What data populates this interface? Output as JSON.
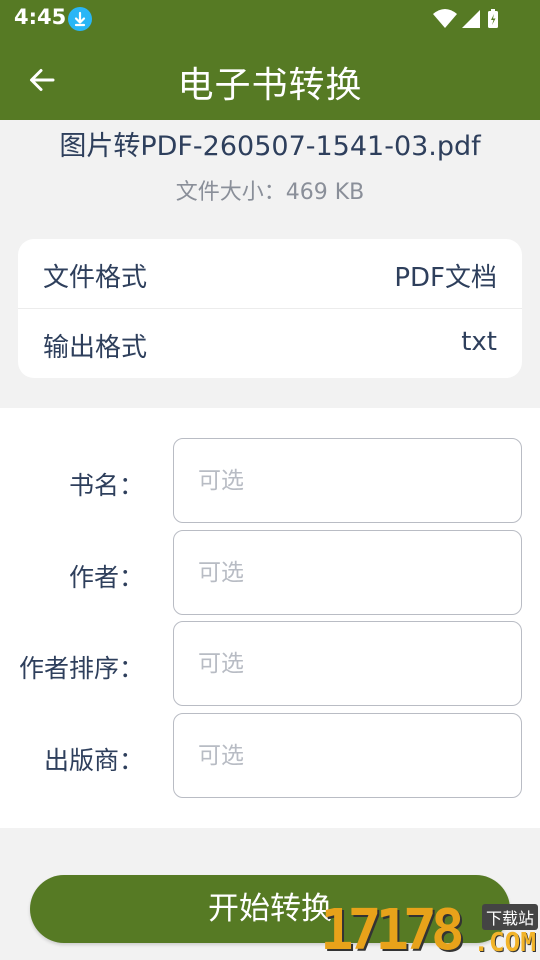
{
  "status_bar": {
    "time": "4:45"
  },
  "app_bar": {
    "title": "电子书转换"
  },
  "file": {
    "name": "图片转PDF-260507-1541-03.pdf",
    "size_text": "文件大小：469 KB"
  },
  "info": [
    {
      "label": "文件格式",
      "value": "PDF文档"
    },
    {
      "label": "输出格式",
      "value": "txt"
    }
  ],
  "form": {
    "fields": [
      {
        "label": "书名：",
        "placeholder": "可选"
      },
      {
        "label": "作者：",
        "placeholder": "可选"
      },
      {
        "label": "作者排序：",
        "placeholder": "可选"
      },
      {
        "label": "出版商：",
        "placeholder": "可选"
      }
    ]
  },
  "actions": {
    "start_label": "开始转换"
  },
  "watermark": {
    "digits": "17178",
    "domain": ".COM",
    "tag": "下载站"
  },
  "colors": {
    "primary": "#567a24",
    "text": "#2e3f5c",
    "muted": "#8a8f99",
    "background": "#f2f2f2"
  }
}
